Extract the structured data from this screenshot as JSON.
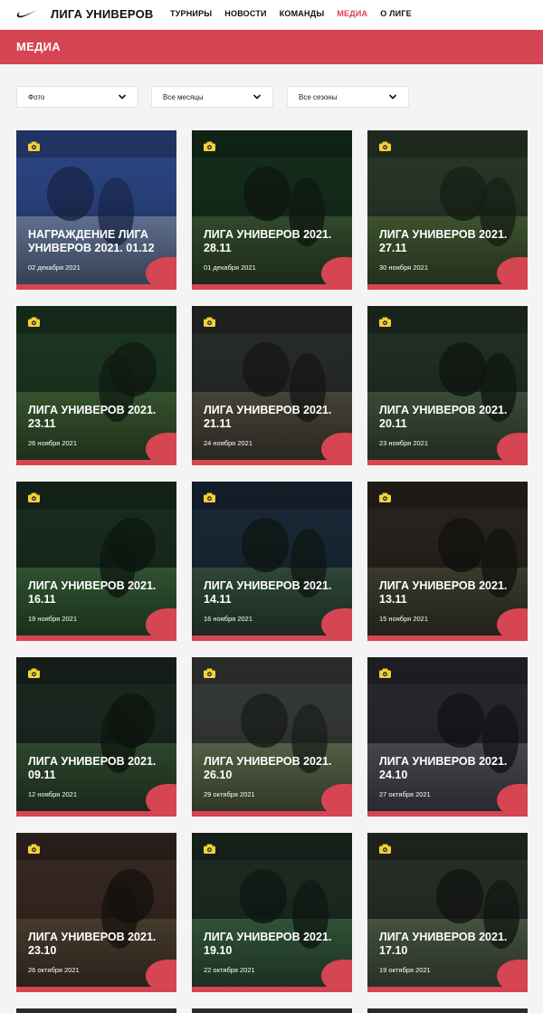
{
  "header": {
    "brand": "ЛИГА УНИВЕРОВ",
    "nav": [
      {
        "label": "ТУРНИРЫ",
        "active": false
      },
      {
        "label": "НОВОСТИ",
        "active": false
      },
      {
        "label": "КОМАНДЫ",
        "active": false
      },
      {
        "label": "МЕДИА",
        "active": true
      },
      {
        "label": "О ЛИГЕ",
        "active": false
      }
    ]
  },
  "banner": {
    "title": "МЕДИА"
  },
  "filters": [
    {
      "value": "Фото"
    },
    {
      "value": "Все месяцы"
    },
    {
      "value": "Все сезоны"
    }
  ],
  "accent_color": "#d64552",
  "cards": [
    {
      "title": "НАГРАЖДЕНИЕ ЛИГА УНИВЕРОВ 2021. 01.12",
      "date": "02 декабря 2021",
      "icon": "camera-icon"
    },
    {
      "title": "ЛИГА УНИВЕРОВ 2021. 28.11",
      "date": "01 декабря 2021",
      "icon": "camera-icon"
    },
    {
      "title": "ЛИГА УНИВЕРОВ 2021. 27.11",
      "date": "30 ноября 2021",
      "icon": "camera-icon"
    },
    {
      "title": "ЛИГА УНИВЕРОВ 2021. 23.11",
      "date": "26 ноября 2021",
      "icon": "camera-icon"
    },
    {
      "title": "ЛИГА УНИВЕРОВ 2021. 21.11",
      "date": "24 ноября 2021",
      "icon": "camera-icon"
    },
    {
      "title": "ЛИГА УНИВЕРОВ 2021. 20.11",
      "date": "23 ноября 2021",
      "icon": "camera-icon"
    },
    {
      "title": "ЛИГА УНИВЕРОВ 2021. 16.11",
      "date": "19 ноября 2021",
      "icon": "camera-icon"
    },
    {
      "title": "ЛИГА УНИВЕРОВ 2021. 14.11",
      "date": "16 ноября 2021",
      "icon": "camera-icon"
    },
    {
      "title": "ЛИГА УНИВЕРОВ 2021. 13.11",
      "date": "15 ноября 2021",
      "icon": "camera-icon"
    },
    {
      "title": "ЛИГА УНИВЕРОВ 2021. 09.11",
      "date": "12 ноября 2021",
      "icon": "camera-icon"
    },
    {
      "title": "ЛИГА УНИВЕРОВ 2021. 26.10",
      "date": "29 октября 2021",
      "icon": "camera-icon"
    },
    {
      "title": "ЛИГА УНИВЕРОВ 2021. 24.10",
      "date": "27 октября 2021",
      "icon": "camera-icon"
    },
    {
      "title": "ЛИГА УНИВЕРОВ 2021. 23.10",
      "date": "26 октября 2021",
      "icon": "camera-icon"
    },
    {
      "title": "ЛИГА УНИВЕРОВ 2021. 19.10",
      "date": "22 октября 2021",
      "icon": "camera-icon"
    },
    {
      "title": "ЛИГА УНИВЕРОВ 2021. 17.10",
      "date": "19 октября 2021",
      "icon": "camera-icon"
    }
  ]
}
